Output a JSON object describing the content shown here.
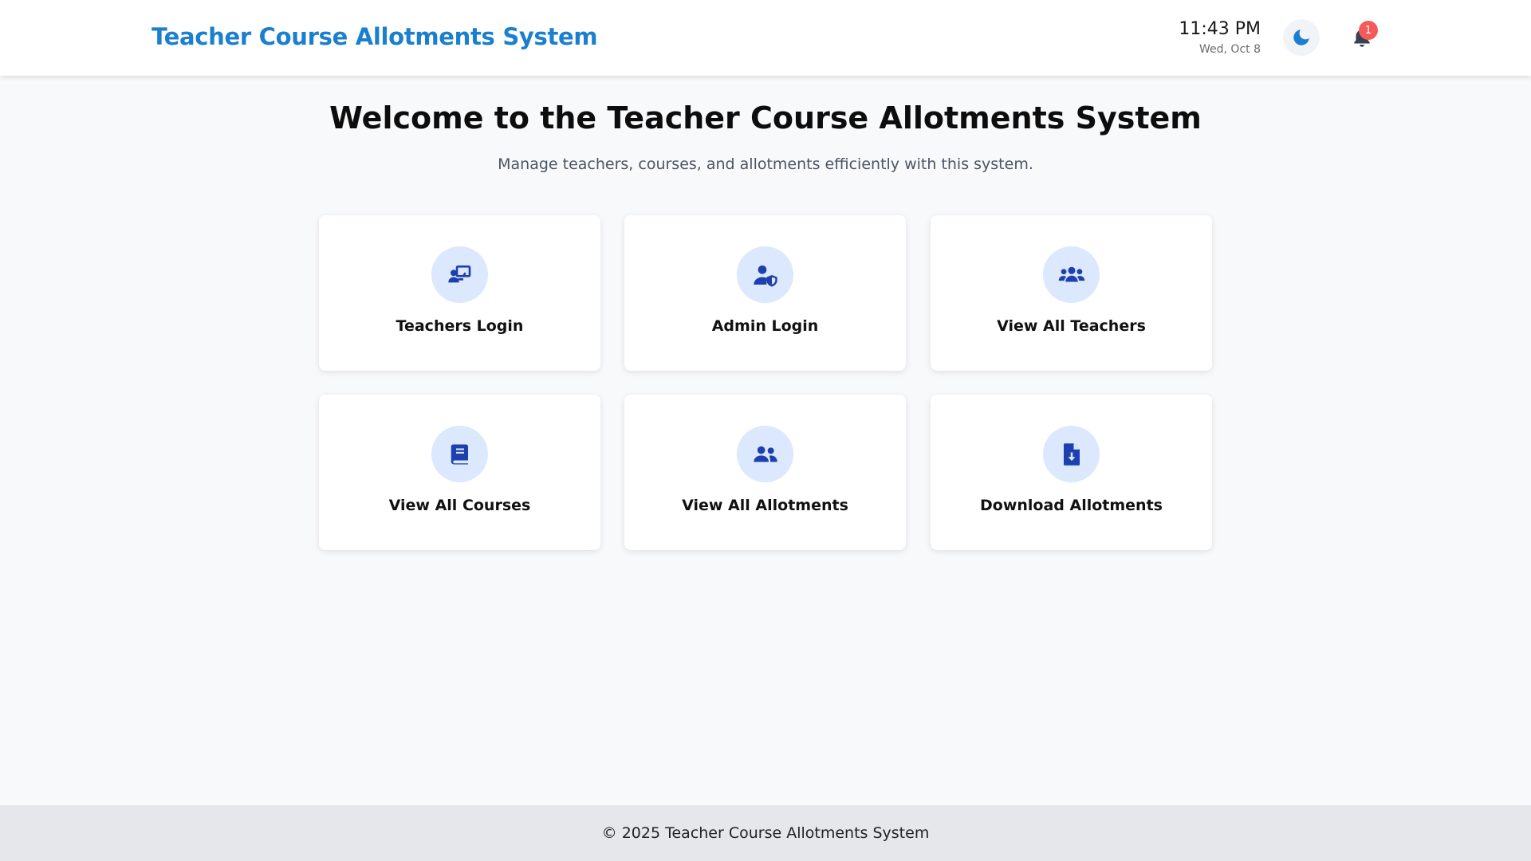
{
  "header": {
    "brand": "Teacher Course Allotments System",
    "time": "11:43 PM",
    "date": "Wed, Oct 8",
    "notification_count": "1"
  },
  "hero": {
    "title": "Welcome to the Teacher Course Allotments System",
    "subtitle": "Manage teachers, courses, and allotments efficiently with this system."
  },
  "cards": [
    {
      "label": "Teachers Login",
      "icon": "chalkboard-teacher-icon"
    },
    {
      "label": "Admin Login",
      "icon": "user-shield-icon"
    },
    {
      "label": "View All Teachers",
      "icon": "users-icon"
    },
    {
      "label": "View All Courses",
      "icon": "book-icon"
    },
    {
      "label": "View All Allotments",
      "icon": "user-group-icon"
    },
    {
      "label": "Download Allotments",
      "icon": "file-download-icon"
    }
  ],
  "footer": {
    "text": "© 2025 Teacher Course Allotments System"
  },
  "colors": {
    "brand": "#1a7fcf",
    "icon": "#1e40af",
    "icon_bg": "#dbe8fd",
    "badge": "#f55a5a"
  }
}
